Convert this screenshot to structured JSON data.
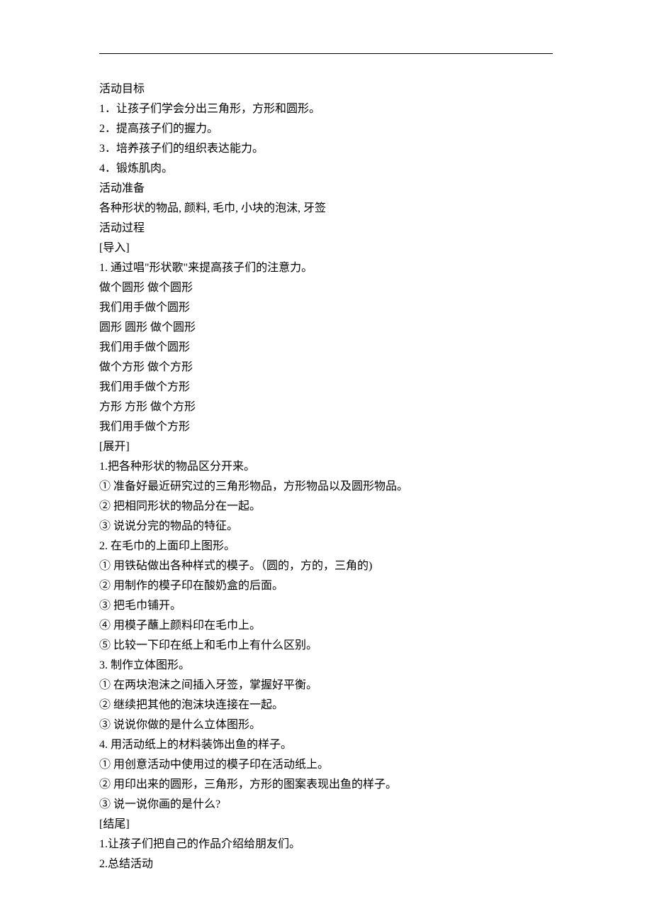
{
  "lines": [
    "活动目标",
    "1．让孩子们学会分出三角形，方形和圆形。",
    "2．提高孩子们的握力。",
    "3．培养孩子们的组织表达能力。",
    "4．锻炼肌肉。",
    "活动准备",
    "各种形状的物品, 颜料, 毛巾, 小块的泡沫, 牙签",
    "活动过程",
    "[导入]",
    "1. 通过唱\"形状歌\"来提高孩子们的注意力。",
    "做个圆形 做个圆形",
    "我们用手做个圆形",
    "圆形 圆形 做个圆形",
    "我们用手做个圆形",
    "做个方形 做个方形",
    "我们用手做个方形",
    "方形 方形 做个方形",
    "我们用手做个方形",
    "[展开]",
    "1.把各种形状的物品区分开来。",
    "① 准备好最近研究过的三角形物品，方形物品以及圆形物品。",
    "② 把相同形状的物品分在一起。",
    "③ 说说分完的物品的特征。",
    "2. 在毛巾的上面印上图形。",
    "① 用铁砧做出各种样式的模子。（圆的，方的，三角的)",
    "② 用制作的模子印在酸奶盒的后面。",
    "③ 把毛巾铺开。",
    "④ 用模子蘸上颜料印在毛巾上。",
    "⑤ 比较一下印在纸上和毛巾上有什么区别。",
    "3. 制作立体图形。",
    "① 在两块泡沫之间插入牙签，掌握好平衡。",
    "② 继续把其他的泡沫块连接在一起。",
    "③ 说说你做的是什么立体图形。",
    "4. 用活动纸上的材料装饰出鱼的样子。",
    "① 用创意活动中使用过的模子印在活动纸上。",
    "② 用印出来的圆形，三角形，方形的图案表现出鱼的样子。",
    "③ 说一说你画的是什么?",
    "[结尾]",
    "1.让孩子们把自己的作品介绍给朋友们。",
    "2.总结活动"
  ]
}
